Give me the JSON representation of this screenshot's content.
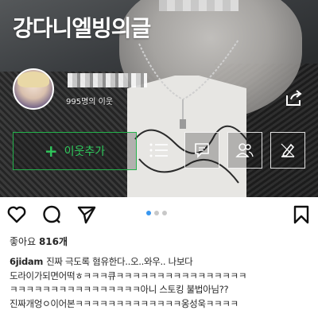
{
  "blog": {
    "title": "강다니엘빙의글",
    "neighbor_count": "995명의 이웃",
    "add_neighbor_label": "이웃추가",
    "add_neighbor_symbol": "+",
    "colors": {
      "accent_green": "#2ec85b",
      "text_light": "#ffffff"
    },
    "actions": [
      "menu-list-icon",
      "comment-icon",
      "people-icon",
      "edit-icon"
    ]
  },
  "post": {
    "likes_label": "좋아요",
    "likes_count": "816개",
    "carousel": {
      "total": 3,
      "active": 1
    },
    "caption": {
      "username": "6jidam",
      "lines": [
        "진짜 극도록 혐유한다..오..와우.. 나보다",
        "도라이가되면어떡ㅎㅋㅋㅋ큐ㅋㅋㅋㅋㅋㅋㅋㅋㅋㅋㅋㅋㅋㅋㅋㅋ",
        "ㅋㅋㅋㅋㅋㅋㅋㅋㅋㅋㅋㅋㅋㅋㅋㅋ아니 스토킹 불법아님??",
        "진짜개엉ㅇ이어본ㅋㅋㅋㅋㅋㅋㅋㅋㅋㅋㅋㅋㅋ옹성욱ㅋㅋㅋㅋ"
      ]
    },
    "icons": [
      "heart-icon",
      "comment-bubble-icon",
      "send-icon",
      "bookmark-icon"
    ],
    "colors": {
      "dot_active": "#3897f0",
      "dot_inactive": "#c8c8c8",
      "text": "#262626"
    }
  }
}
